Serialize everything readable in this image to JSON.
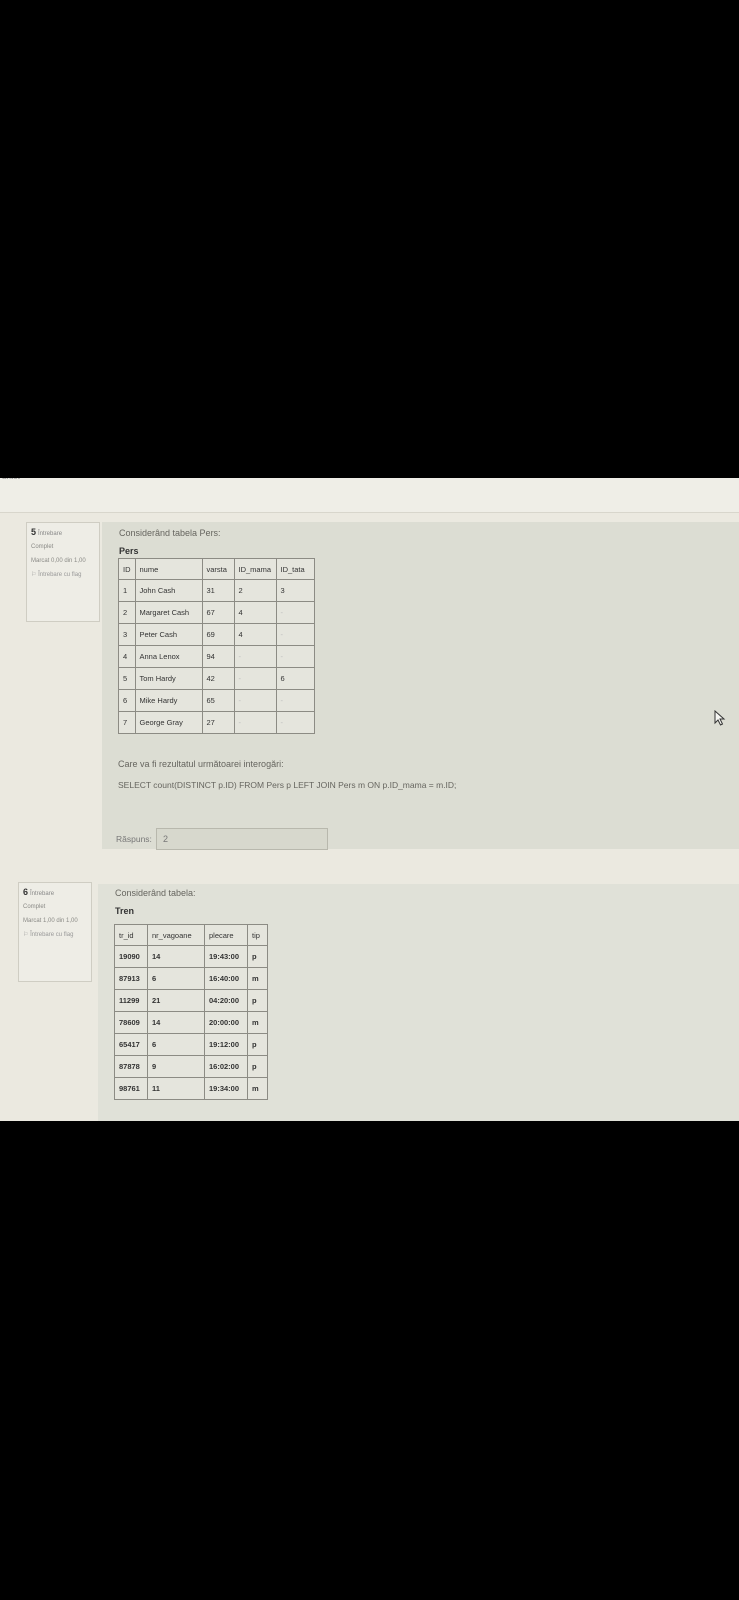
{
  "header": {
    "crumb": "antet"
  },
  "questions": [
    {
      "number": "5",
      "word": "Întrebare",
      "status": "Complet",
      "mark": "Marcat 0,00 din 1,00",
      "flag_label": "Întrebare cu flag",
      "intro": "Considerând tabela Pers:",
      "table_name": "Pers",
      "columns": [
        "ID",
        "nume",
        "varsta",
        "ID_mama",
        "ID_tata"
      ],
      "rows": [
        [
          "1",
          "John Cash",
          "31",
          "2",
          "3"
        ],
        [
          "2",
          "Margaret Cash",
          "67",
          "4",
          "-"
        ],
        [
          "3",
          "Peter Cash",
          "69",
          "4",
          "-"
        ],
        [
          "4",
          "Anna Lenox",
          "94",
          "-",
          "-"
        ],
        [
          "5",
          "Tom Hardy",
          "42",
          "-",
          "6"
        ],
        [
          "6",
          "Mike Hardy",
          "65",
          "-",
          "-"
        ],
        [
          "7",
          "George Gray",
          "27",
          "-",
          "-"
        ]
      ],
      "question": "Care va fi rezultatul următoarei interogări:",
      "sql": "SELECT count(DISTINCT p.ID) FROM Pers p LEFT JOIN Pers m ON p.ID_mama = m.ID;",
      "answer_label": "Răspuns:",
      "answer_value": "2"
    },
    {
      "number": "6",
      "word": "Întrebare",
      "status": "Complet",
      "mark": "Marcat 1,00 din 1,00",
      "flag_label": "Întrebare cu flag",
      "intro": "Considerând tabela:",
      "table_name": "Tren",
      "columns": [
        "tr_id",
        "nr_vagoane",
        "plecare",
        "tip"
      ],
      "rows": [
        [
          "19090",
          "14",
          "19:43:00",
          "p"
        ],
        [
          "87913",
          "6",
          "16:40:00",
          "m"
        ],
        [
          "11299",
          "21",
          "04:20:00",
          "p"
        ],
        [
          "78609",
          "14",
          "20:00:00",
          "m"
        ],
        [
          "65417",
          "6",
          "19:12:00",
          "p"
        ],
        [
          "87878",
          "9",
          "16:02:00",
          "p"
        ],
        [
          "98761",
          "11",
          "19:34:00",
          "m"
        ]
      ]
    }
  ]
}
